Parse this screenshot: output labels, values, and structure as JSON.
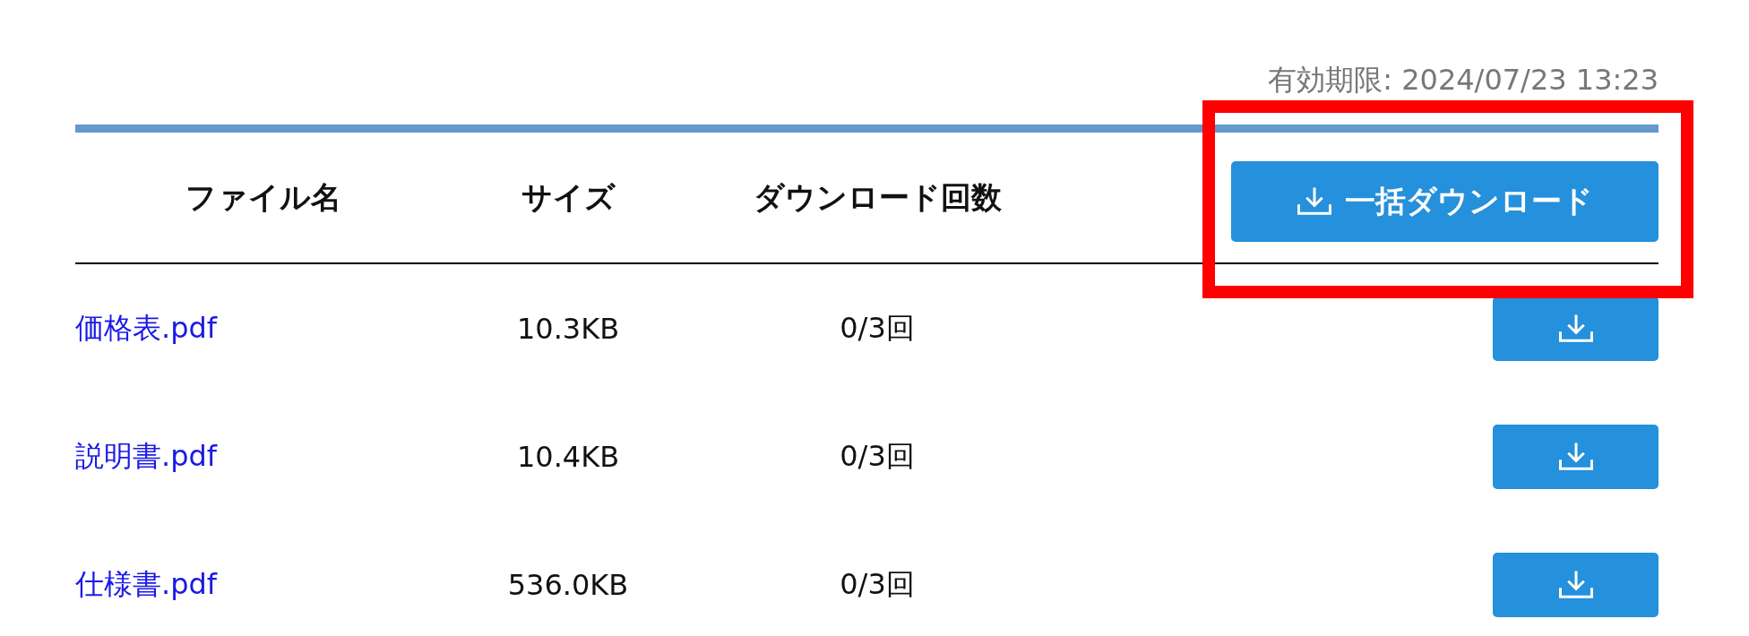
{
  "expiry": "有効期限: 2024/07/23 13:23",
  "table": {
    "columns": [
      "ファイル名",
      "サイズ",
      "ダウンロード回数"
    ],
    "bulk_download_button": "一括ダウンロード",
    "rows": [
      {
        "file_name": "価格表.pdf",
        "size": "10.3KB",
        "downloads": "0/3回"
      },
      {
        "file_name": "説明書.pdf",
        "size": "10.4KB",
        "downloads": "0/3回"
      },
      {
        "file_name": "仕様書.pdf",
        "size": "536.0KB",
        "downloads": "0/3回"
      }
    ]
  },
  "annotation": {
    "kind": "highlight-box"
  }
}
